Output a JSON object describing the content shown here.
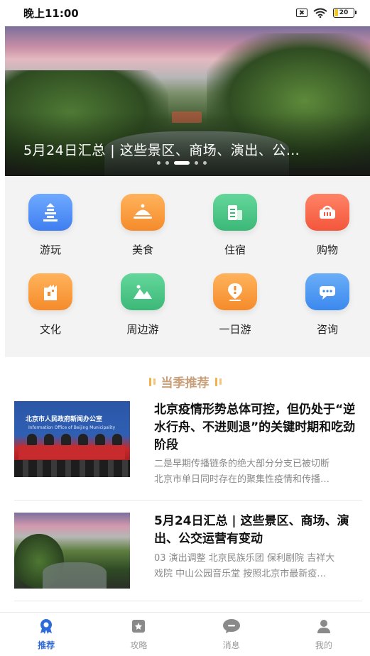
{
  "status_bar": {
    "time": "晚上11:00",
    "battery": "20"
  },
  "banner": {
    "title": "5月24日汇总 | 这些景区、商场、演出、公…",
    "slide_count": 5,
    "active_slide": 3
  },
  "categories": [
    {
      "label": "游玩",
      "icon": "pagoda-icon",
      "color": "#4f8cf5"
    },
    {
      "label": "美食",
      "icon": "food-cloche-icon",
      "color": "#f7a043"
    },
    {
      "label": "住宿",
      "icon": "hotel-building-icon",
      "color": "#4ac886"
    },
    {
      "label": "购物",
      "icon": "shopping-basket-icon",
      "color": "#f4684d"
    },
    {
      "label": "文化",
      "icon": "castle-icon",
      "color": "#f7a043"
    },
    {
      "label": "周边游",
      "icon": "mountain-picture-icon",
      "color": "#4ac886"
    },
    {
      "label": "一日游",
      "icon": "location-pin-icon",
      "color": "#f7a043"
    },
    {
      "label": "咨询",
      "icon": "chat-bubble-icon",
      "color": "#4f8cf5"
    }
  ],
  "recommend": {
    "title": "当季推荐"
  },
  "articles": [
    {
      "headline": "北京疫情形势总体可控，但仍处于“逆水行舟、不进则退”的关键时期和吃劲阶段",
      "summary_line1": "二是早期传播链条的绝大部分分支已被切断",
      "summary_line2": "北京市单日同时存在的聚集性疫情和传播…",
      "thumb_title": "北京市人民政府新闻办公室",
      "thumb_subtitle": "Information Office of Beijing Municipality"
    },
    {
      "headline": "5月24日汇总 | 这些景区、商场、演出、公交运营有变动",
      "summary_line1": "03 演出调整 北京民族乐团 保利剧院 吉祥大",
      "summary_line2": "戏院 中山公园音乐堂 按照北京市最新疫…"
    }
  ],
  "tabbar": {
    "tabs": [
      {
        "label": "推荐",
        "icon": "recommend-badge-icon",
        "active": true
      },
      {
        "label": "攻略",
        "icon": "guide-book-icon",
        "active": false
      },
      {
        "label": "消息",
        "icon": "message-bubble-icon",
        "active": false
      },
      {
        "label": "我的",
        "icon": "user-profile-icon",
        "active": false
      }
    ]
  },
  "colors": {
    "accent": "#2f6bd8",
    "section_title": "#c9a07a",
    "grid_background": "#f3f3f3"
  }
}
